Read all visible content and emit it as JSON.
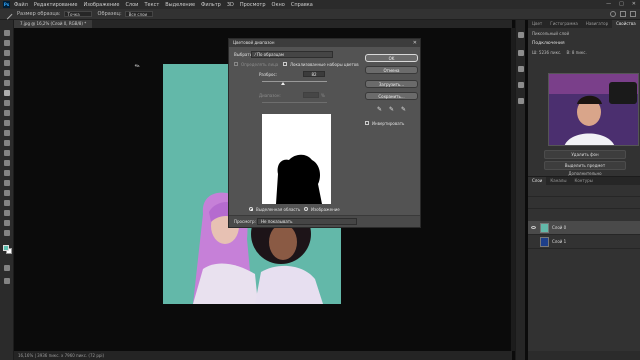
{
  "menubar": {
    "app_icon": "Ps",
    "items": [
      "Файл",
      "Редактирование",
      "Изображение",
      "Слои",
      "Текст",
      "Выделение",
      "Фильтр",
      "3D",
      "Просмотр",
      "Окно",
      "Справка"
    ],
    "window_controls": [
      "—",
      "□",
      "✕"
    ]
  },
  "options_bar": {
    "sample_size_label": "Размер образца:",
    "sample_size_value": "Точка",
    "sample_label": "Образец:",
    "sample_value": "Все слои"
  },
  "document": {
    "tab_label": "7.jpg @ 16,2% (Слой 0, RGB/8) *",
    "status": "16,16%  |  3936 пикс. x 7960 пикс. (72 ppi)"
  },
  "panels": {
    "top_tabs": [
      "Цвет",
      "Гистограмма",
      "Навигатор",
      "Свойства"
    ],
    "properties": {
      "header": "Пиксельный слой",
      "subheader": "Подключения",
      "dims": [
        "Ш: 5236 пикс.",
        "В: 8 пикс."
      ],
      "remove_bg_button": "Удалить фон",
      "select_subject_button": "Выделить предмет",
      "more_link": "Дополнительно"
    },
    "layers_tabs": [
      "Слои",
      "Каналы",
      "Контуры"
    ],
    "layers": [
      {
        "name": "Слой 0"
      },
      {
        "name": "Слой 1"
      }
    ]
  },
  "dialog": {
    "title": "Цветовой диапазон",
    "close": "✕",
    "select_label": "Выбрать:",
    "select_value": "По образцам",
    "detect_faces_label": "Определять лица",
    "localized_label": "Локализованные наборы цветов",
    "fuzziness_label": "Разброс:",
    "fuzziness_value": "82",
    "range_label": "Диапазон:",
    "range_unit": "%",
    "ok_button": "OK",
    "cancel_button": "Отмена",
    "load_button": "Загрузить...",
    "save_button": "Сохранить...",
    "invert_label": "Инвертировать",
    "radio_selection": "Выделенная область",
    "radio_image": "Изображение",
    "preview_label": "Просмотр:",
    "preview_value": "Не показывать",
    "fuzziness_fraction": 0.32
  },
  "colors": {
    "canvas_bg": "#63b8a9",
    "accent": "#31a8ff"
  }
}
